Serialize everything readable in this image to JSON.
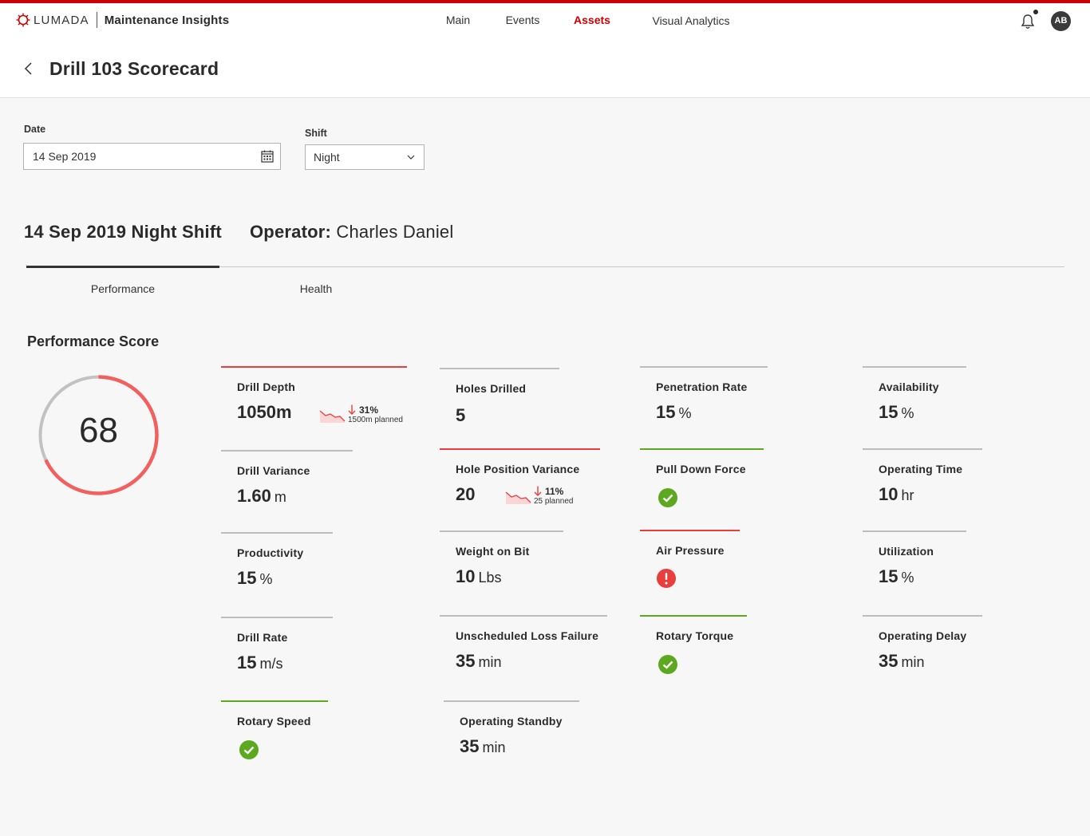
{
  "header": {
    "brand": "LUMADA",
    "app_title": "Maintenance Insights",
    "nav": [
      {
        "label": "Main",
        "active": false
      },
      {
        "label": "Events",
        "active": false
      },
      {
        "label": "Assets",
        "active": true
      },
      {
        "label": "Visual Analytics",
        "active": false
      }
    ],
    "user_initials": "AB",
    "accent_color": "#cc0000"
  },
  "page": {
    "title": "Drill 103 Scorecard"
  },
  "filters": {
    "date_label": "Date",
    "date_value": "14 Sep 2019",
    "shift_label": "Shift",
    "shift_value": "Night"
  },
  "summary": {
    "shift_heading": "14 Sep 2019 Night Shift",
    "operator_label": "Operator:",
    "operator_name": "Charles Daniel"
  },
  "tabs": [
    {
      "label": "Performance",
      "active": true
    },
    {
      "label": "Health",
      "active": false
    }
  ],
  "score": {
    "title": "Performance Score",
    "value": "68",
    "fraction": 0.68
  },
  "kpis": {
    "drill_depth": {
      "label": "Drill Depth",
      "value": "1050m",
      "unit": "",
      "status": "red",
      "trend": {
        "direction": "down",
        "pct": "31%",
        "planned": "1500m planned"
      }
    },
    "drill_variance": {
      "label": "Drill Variance",
      "value": "1.60",
      "unit": "m",
      "status": "neutral"
    },
    "productivity": {
      "label": "Productivity",
      "value": "15",
      "unit": "%",
      "status": "neutral"
    },
    "drill_rate": {
      "label": "Drill Rate",
      "value": "15",
      "unit": "m/s",
      "status": "neutral"
    },
    "rotary_speed": {
      "label": "Rotary Speed",
      "status": "green",
      "icon": "check-circle-icon"
    },
    "holes_drilled": {
      "label": "Holes Drilled",
      "value": "5",
      "unit": "",
      "status": "neutral"
    },
    "hole_position_variance": {
      "label": "Hole Position Variance",
      "value": "20",
      "unit": "",
      "status": "red",
      "trend": {
        "direction": "down",
        "pct": "11%",
        "planned": "25 planned"
      }
    },
    "weight_on_bit": {
      "label": "Weight on Bit",
      "value": "10",
      "unit": "Lbs",
      "status": "neutral"
    },
    "unscheduled_loss_failure": {
      "label": "Unscheduled Loss Failure",
      "value": "35",
      "unit": "min",
      "status": "neutral"
    },
    "operating_standby": {
      "label": "Operating Standby",
      "value": "35",
      "unit": "min",
      "status": "neutral"
    },
    "penetration_rate": {
      "label": "Penetration Rate",
      "value": "15",
      "unit": "%",
      "status": "neutral"
    },
    "pull_down_force": {
      "label": "Pull Down Force",
      "status": "green",
      "icon": "check-circle-icon"
    },
    "air_pressure": {
      "label": "Air Pressure",
      "status": "red",
      "icon": "alert-circle-icon"
    },
    "rotary_torque": {
      "label": "Rotary Torque",
      "status": "green",
      "icon": "check-circle-icon"
    },
    "availability": {
      "label": "Availability",
      "value": "15",
      "unit": "%",
      "status": "neutral"
    },
    "operating_time": {
      "label": "Operating Time",
      "value": "10",
      "unit": "hr",
      "status": "neutral"
    },
    "utilization": {
      "label": "Utilization",
      "value": "15",
      "unit": "%",
      "status": "neutral"
    },
    "operating_delay": {
      "label": "Operating Delay",
      "value": "35",
      "unit": "min",
      "status": "neutral"
    }
  },
  "colors": {
    "status_red": "#e83e3e",
    "status_green": "#5ca81e",
    "neutral_bar": "#bdbdbd"
  }
}
